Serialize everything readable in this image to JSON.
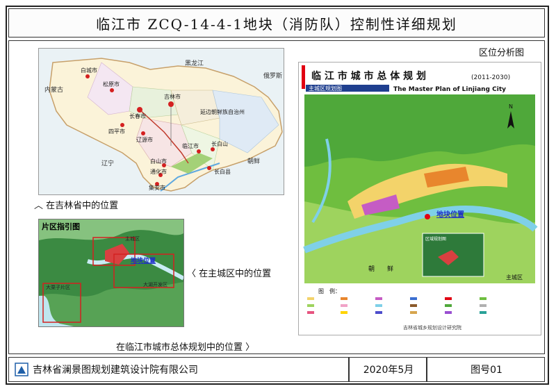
{
  "title": "临江市 ZCQ-14-4-1地块（消防队）控制性详细规划",
  "section_label": "区位分析图",
  "province_map": {
    "caption": "在吉林省中的位置",
    "labels": {
      "heilongjiang": "黑龙江",
      "neimenggu": "内蒙古",
      "liaoning": "辽宁",
      "russia": "俄罗斯",
      "korea": "朝鲜",
      "baicheng": "白城市",
      "songyuan": "松原市",
      "changchun": "长春市",
      "jilin": "吉林市",
      "siping": "四平市",
      "liaoyuan": "辽源市",
      "yanbian": "延边朝鲜族自治州",
      "linjiang": "临江市",
      "changbaishan": "长白山",
      "baishan": "白山市",
      "tonghua": "通化市",
      "jian": "集安市",
      "changbai": "长白县"
    }
  },
  "district_map": {
    "header": "片区指引图",
    "caption": "在主城区中的位置",
    "labels": {
      "main": "主城区",
      "site": "地块位置",
      "dalizi": "大栗子片区",
      "dahu": "大湖开发区"
    }
  },
  "master_plan": {
    "title_cn": "临 江 市 城 市 总 体 规 划",
    "years": "(2011-2030)",
    "subtitle_cn": "主城区规划图",
    "title_en": "The Master Plan of Linjiang City",
    "site_label": "地块位置",
    "korea_label": "朝　　鲜",
    "main_label": "主城区",
    "inset_label": "区域规划图",
    "legend_title": "图　例：",
    "institute": "吉林省城乡规划设计研究院",
    "caption": "在临江市城市总体规划中的位置"
  },
  "footer": {
    "company": "吉林省澜景图规划建筑设计院有限公司",
    "date": "2020年5月",
    "drawing_no": "图号01"
  },
  "colors": {
    "plan_red": "#e10012",
    "plan_green": "#6fbe3f",
    "river": "#7fd0e8",
    "highlight_box": "#d42020",
    "site_label_blue": "#1d2ec8"
  }
}
